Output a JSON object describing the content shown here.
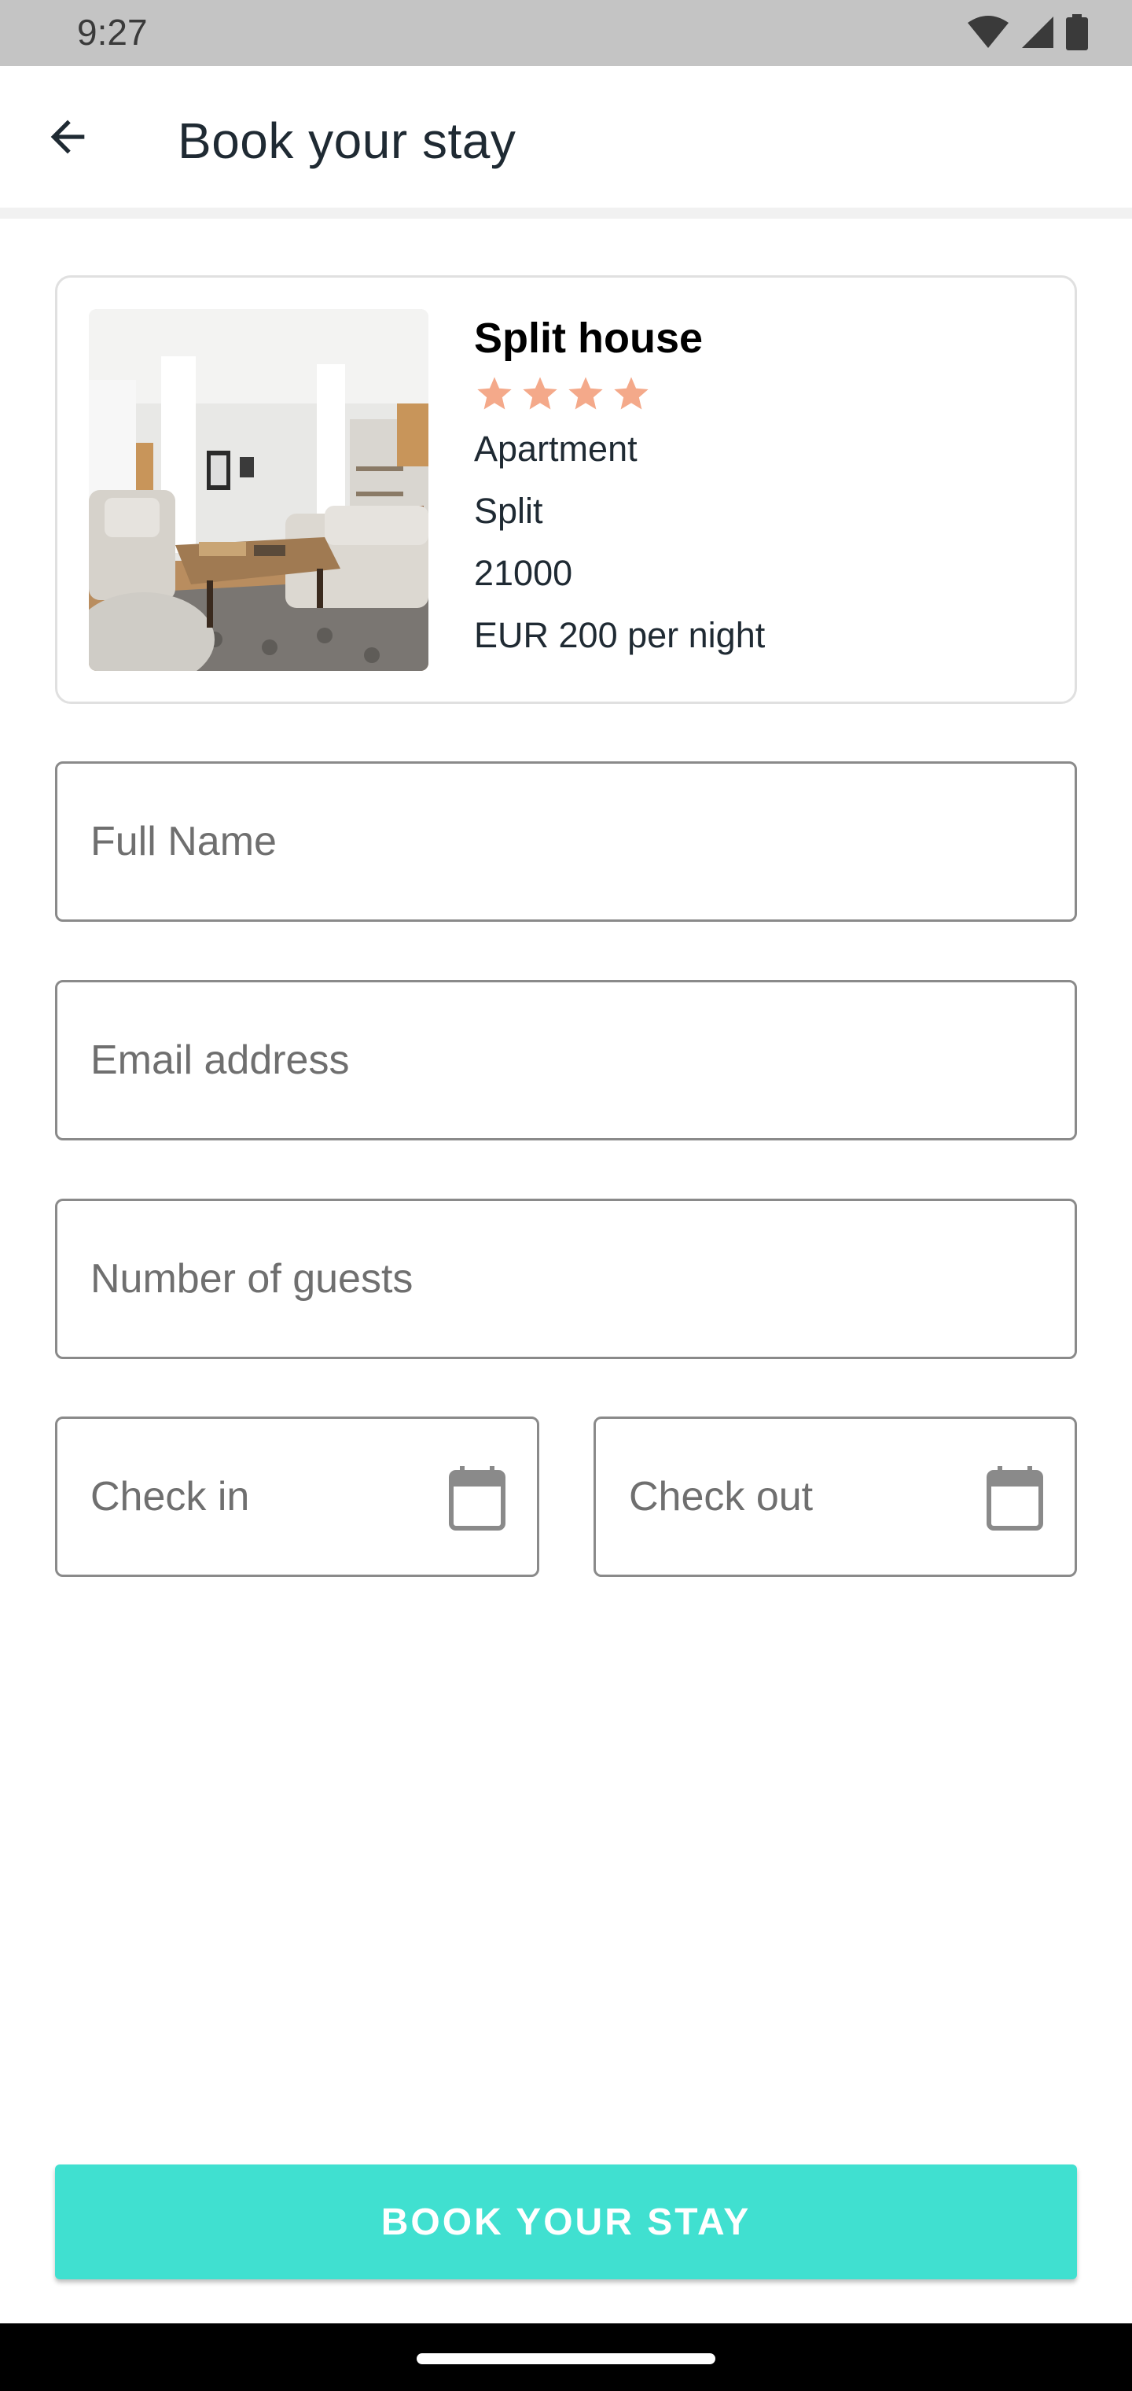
{
  "status_bar": {
    "time": "9:27",
    "icons": [
      "wifi-icon",
      "cellular-signal-icon",
      "battery-icon"
    ]
  },
  "app_bar": {
    "back_icon": "arrow-back-icon",
    "title": "Book your stay"
  },
  "property": {
    "name": "Split house",
    "rating": 4,
    "star_color": "#f4a98a",
    "type": "Apartment",
    "city": "Split",
    "postal_code": "21000",
    "price": "EUR 200 per night",
    "image": "living-room-photo"
  },
  "form": {
    "full_name": {
      "placeholder": "Full Name",
      "value": ""
    },
    "email": {
      "placeholder": "Email address",
      "value": ""
    },
    "guests": {
      "placeholder": "Number of guests",
      "value": ""
    },
    "check_in": {
      "placeholder": "Check in",
      "value": "",
      "icon": "calendar-icon"
    },
    "check_out": {
      "placeholder": "Check out",
      "value": "",
      "icon": "calendar-icon"
    }
  },
  "actions": {
    "book_label": "BOOK YOUR STAY"
  },
  "colors": {
    "accent": "#40e0d0",
    "title_text": "#1f2a33",
    "status_bar": "#c4c4c4"
  }
}
